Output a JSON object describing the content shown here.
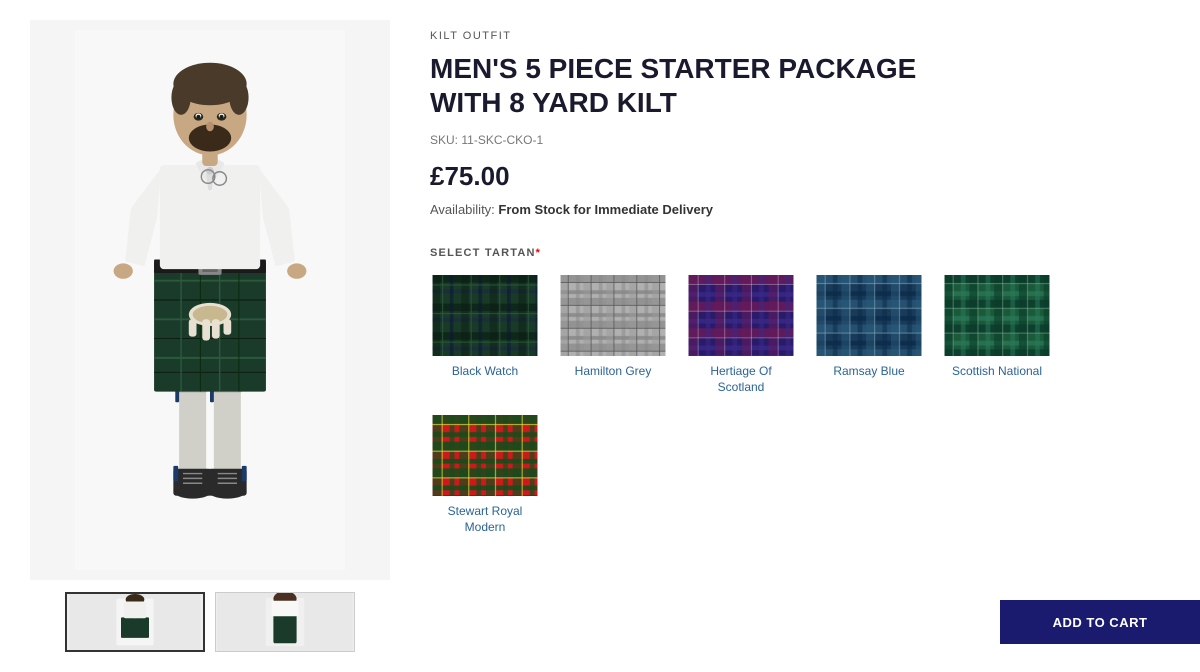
{
  "category": "KILT OUTFIT",
  "title": "MEN'S 5 PIECE STARTER PACKAGE WITH 8 YARD KILT",
  "sku_label": "SKU:",
  "sku": "11-SKC-CKO-1",
  "price": "£75.00",
  "availability_label": "Availability:",
  "availability_value": "From Stock for Immediate Delivery",
  "tartan_section_label": "SELECT TARTAN",
  "required_marker": "*",
  "tartans": [
    {
      "id": "black-watch",
      "name": "Black Watch",
      "colors": [
        "#1a4a2e",
        "#0a2a1a",
        "#2a6a4a",
        "#1a1a40"
      ]
    },
    {
      "id": "hamilton-grey",
      "name": "Hamilton Grey",
      "colors": [
        "#a0a0a0",
        "#808080",
        "#c0b8b0",
        "#6a6a6a"
      ]
    },
    {
      "id": "heritage-of-scotland",
      "name": "Hertiage Of Scotland",
      "colors": [
        "#3a2a8a",
        "#8a2a6a",
        "#2a4a8a",
        "#1a1a60"
      ]
    },
    {
      "id": "ramsay-blue",
      "name": "Ramsay Blue",
      "colors": [
        "#1a4a6a",
        "#2a6a8a",
        "#4a8aaa",
        "#0a2a4a"
      ]
    },
    {
      "id": "scottish-national",
      "name": "Scottish National",
      "colors": [
        "#1a6a4a",
        "#2a8a6a",
        "#4aaa8a",
        "#0a4a2a"
      ]
    },
    {
      "id": "stewart-royal-modern",
      "name": "Stewart Royal Modern",
      "colors": [
        "#cc1a1a",
        "#1a4a1a",
        "#cc8a1a",
        "#8a1a1a"
      ]
    }
  ],
  "add_to_cart_label": "ADD TO CART"
}
